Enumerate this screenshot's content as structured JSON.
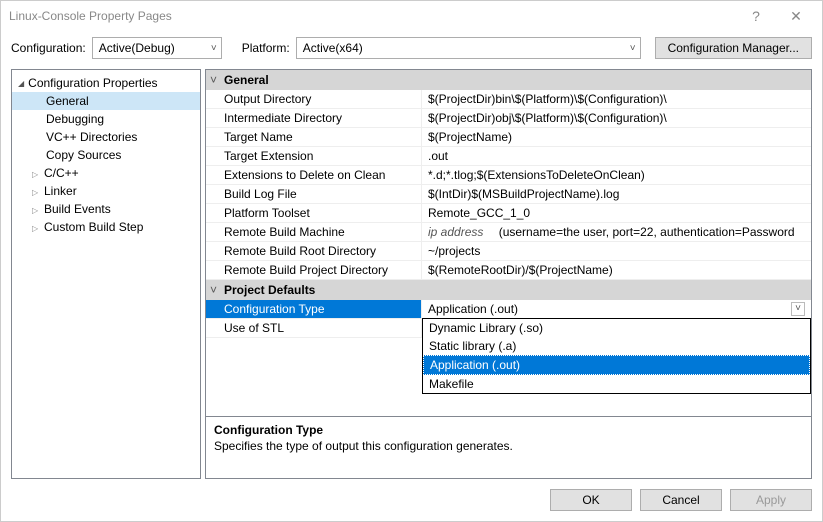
{
  "window": {
    "title": "Linux-Console Property Pages"
  },
  "toolbar": {
    "config_label": "Configuration:",
    "config_value": "Active(Debug)",
    "platform_label": "Platform:",
    "platform_value": "Active(x64)",
    "config_mgr": "Configuration Manager..."
  },
  "tree": {
    "root": "Configuration Properties",
    "items": [
      {
        "label": "General",
        "selected": true,
        "indent": "sub"
      },
      {
        "label": "Debugging",
        "indent": "sub"
      },
      {
        "label": "VC++ Directories",
        "indent": "sub"
      },
      {
        "label": "Copy Sources",
        "indent": "sub"
      },
      {
        "label": "C/C++",
        "indent": "child",
        "expandable": true
      },
      {
        "label": "Linker",
        "indent": "child",
        "expandable": true
      },
      {
        "label": "Build Events",
        "indent": "child",
        "expandable": true
      },
      {
        "label": "Custom Build Step",
        "indent": "child",
        "expandable": true
      }
    ]
  },
  "sections": {
    "general": {
      "title": "General",
      "rows": [
        {
          "label": "Output Directory",
          "value": "$(ProjectDir)bin\\$(Platform)\\$(Configuration)\\"
        },
        {
          "label": "Intermediate Directory",
          "value": "$(ProjectDir)obj\\$(Platform)\\$(Configuration)\\"
        },
        {
          "label": "Target Name",
          "value": "$(ProjectName)"
        },
        {
          "label": "Target Extension",
          "value": ".out"
        },
        {
          "label": "Extensions to Delete on Clean",
          "value": "*.d;*.tlog;$(ExtensionsToDeleteOnClean)"
        },
        {
          "label": "Build Log File",
          "value": "$(IntDir)$(MSBuildProjectName).log"
        },
        {
          "label": "Platform Toolset",
          "value": "Remote_GCC_1_0"
        },
        {
          "label": "Remote Build Machine",
          "value_italic": "ip address",
          "value_rest": "   (username=the user, port=22, authentication=Password"
        },
        {
          "label": "Remote Build Root Directory",
          "value": "~/projects"
        },
        {
          "label": "Remote Build Project Directory",
          "value": "$(RemoteRootDir)/$(ProjectName)"
        }
      ]
    },
    "defaults": {
      "title": "Project Defaults",
      "rows": [
        {
          "label": "Configuration Type",
          "value": "Application (.out)",
          "selected": true
        },
        {
          "label": "Use of STL",
          "value": ""
        }
      ]
    }
  },
  "dropdown": {
    "options": [
      {
        "label": "Dynamic Library (.so)"
      },
      {
        "label": "Static library (.a)"
      },
      {
        "label": "Application (.out)",
        "selected": true
      },
      {
        "label": "Makefile"
      }
    ]
  },
  "description": {
    "title": "Configuration Type",
    "text": "Specifies the type of output this configuration generates."
  },
  "buttons": {
    "ok": "OK",
    "cancel": "Cancel",
    "apply": "Apply"
  }
}
